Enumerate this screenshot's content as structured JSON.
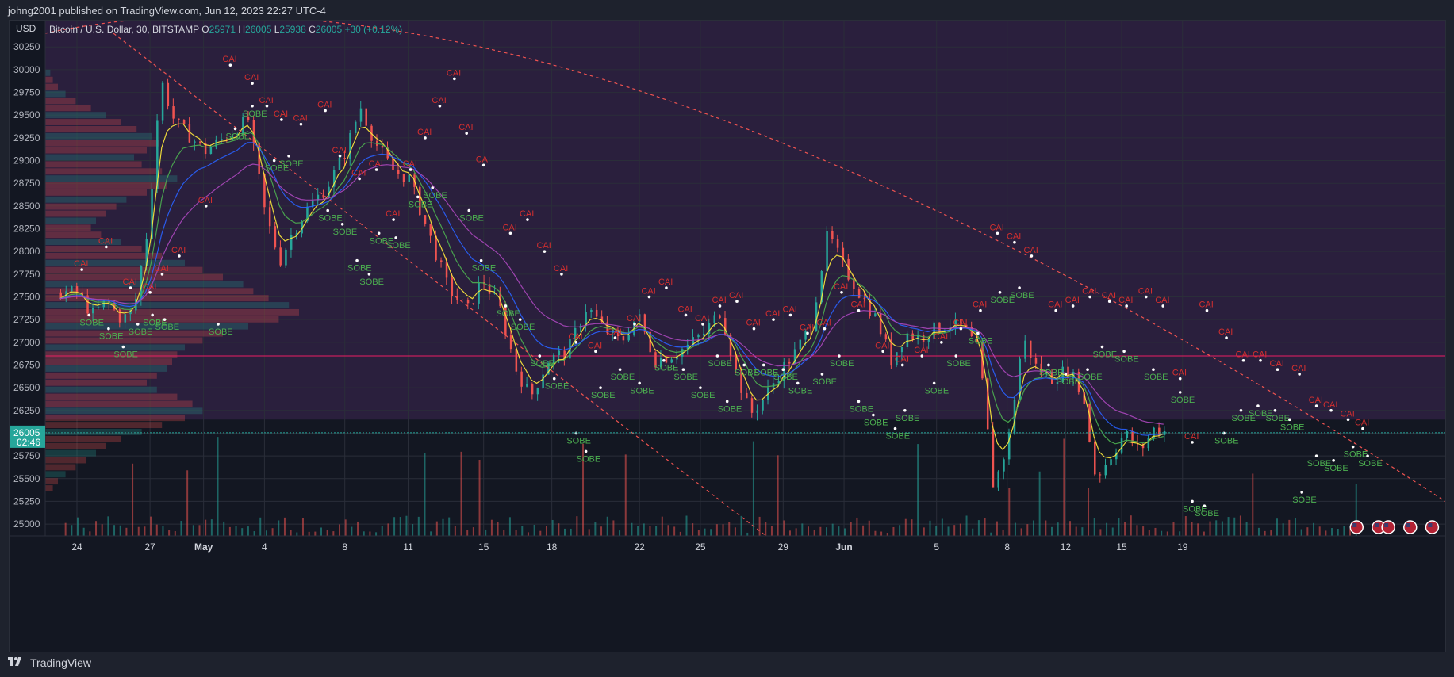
{
  "header": {
    "published": "johng2001 published on TradingView.com, Jun 12, 2023 22:27 UTC-4"
  },
  "footer": {
    "brand": "TradingView",
    "logo_icon": "tradingview-logo-icon"
  },
  "colors": {
    "up": "#26a69a",
    "down": "#ef5350",
    "bg": "#131722",
    "panel_bg": "#1e222d",
    "zone_upper": "#2a1f3d",
    "sobe": "#4caf50",
    "cai": "#d32f2f",
    "ema_fast": "#ffeb3b",
    "ema_mid": "#4caf50",
    "ema_slow": "#2962ff",
    "ema_slowest": "#ab47bc",
    "poc_line": "#e91e63",
    "trend_line": "#ef5350",
    "price_label": "#26a69a",
    "text": "#d1d4dc"
  },
  "chart_data": {
    "type": "candlestick",
    "symbol_line": "Bitcoin / U.S. Dollar, 30, BITSTAMP",
    "currency": "USD",
    "ohlc": {
      "o_label": "O",
      "o": "25971",
      "h_label": "H",
      "h": "26005",
      "l_label": "L",
      "l": "25938",
      "c_label": "C",
      "c": "26005",
      "change": "+30 (+0.12%)"
    },
    "last_price": "26005",
    "countdown": "02:46",
    "ylim": [
      24870,
      30540
    ],
    "y_ticks": [
      "30250",
      "30000",
      "29750",
      "29500",
      "29250",
      "29000",
      "28750",
      "28500",
      "28250",
      "28000",
      "27750",
      "27500",
      "27250",
      "27000",
      "26750",
      "26500",
      "26250",
      "26000",
      "25750",
      "25500",
      "25250",
      "25000"
    ],
    "x_ticks": [
      "24",
      "27",
      "May",
      "4",
      "8",
      "11",
      "15",
      "18",
      "22",
      "25",
      "29",
      "Jun",
      "5",
      "8",
      "12",
      "15",
      "19"
    ],
    "close_path_days": [
      0,
      0.6,
      1.2,
      1.8,
      2.3,
      2.9,
      3.4,
      4.0,
      4.5,
      5.2,
      6.0,
      7.0,
      7.7,
      8.3,
      8.8,
      9.5,
      10.2,
      11.0,
      11.6,
      12.2,
      12.9,
      13.6,
      14.4,
      15.2,
      16.0,
      16.6,
      17.3,
      18.0,
      18.6,
      19.3,
      20.1,
      20.9,
      21.6,
      22.3,
      23.0,
      23.7,
      24.3,
      25.0,
      25.7,
      26.4,
      27.0,
      27.6,
      28.2,
      28.9,
      29.5,
      30.1,
      30.8,
      31.5,
      32.2,
      32.8,
      33.4,
      34.0,
      34.6,
      35.2,
      35.8,
      36.4,
      37.0,
      37.6,
      38.2,
      38.8,
      39.4,
      40.0,
      40.6,
      41.2,
      41.8,
      42.4,
      43.0,
      43.6,
      44.2,
      44.8,
      45.4,
      46.0,
      46.6,
      47.2,
      47.8,
      48.4,
      49.0,
      49.6,
      50.2
    ],
    "close_path": [
      27550,
      27300,
      27450,
      27250,
      27350,
      28300,
      29900,
      29400,
      29300,
      29100,
      29250,
      29450,
      28400,
      27900,
      28200,
      28500,
      28700,
      29100,
      29600,
      29200,
      28900,
      28800,
      28200,
      27600,
      27350,
      27700,
      27400,
      26700,
      26400,
      26800,
      26900,
      27400,
      27150,
      27000,
      27300,
      26800,
      26850,
      26950,
      27100,
      27350,
      26700,
      26200,
      26400,
      26700,
      26900,
      27200,
      28200,
      27800,
      27500,
      27250,
      26800,
      27100,
      27050,
      27150,
      27200,
      27150,
      26900,
      25400,
      25900,
      27050,
      26700,
      26600,
      26700,
      26500,
      25500,
      25750,
      26000,
      25800,
      26050,
      26005
    ],
    "volume_profile_rows": 60,
    "volume_profile": [
      2,
      3,
      5,
      8,
      12,
      18,
      24,
      30,
      36,
      42,
      45,
      40,
      35,
      38,
      46,
      52,
      48,
      40,
      32,
      28,
      24,
      20,
      18,
      22,
      30,
      38,
      46,
      55,
      62,
      70,
      78,
      82,
      88,
      96,
      100,
      92,
      80,
      70,
      62,
      55,
      52,
      50,
      48,
      44,
      40,
      44,
      52,
      58,
      62,
      55,
      46,
      38,
      30,
      24,
      20,
      16,
      12,
      8,
      5,
      3
    ],
    "annotations": {
      "buy_label": "SOBE",
      "sell_label": "CAI"
    },
    "sobe_points": [
      [
        0.5,
        27300
      ],
      [
        1.3,
        27150
      ],
      [
        1.9,
        26950
      ],
      [
        2.5,
        27200
      ],
      [
        3.1,
        27300
      ],
      [
        3.6,
        27250
      ],
      [
        5.8,
        27200
      ],
      [
        6.5,
        29350
      ],
      [
        7.2,
        29600
      ],
      [
        8.1,
        29000
      ],
      [
        8.7,
        29050
      ],
      [
        10.3,
        28450
      ],
      [
        10.9,
        28300
      ],
      [
        11.5,
        27900
      ],
      [
        12.0,
        27750
      ],
      [
        12.4,
        28200
      ],
      [
        13.1,
        28150
      ],
      [
        14.0,
        28600
      ],
      [
        14.6,
        28700
      ],
      [
        16.1,
        28450
      ],
      [
        16.6,
        27900
      ],
      [
        17.6,
        27400
      ],
      [
        18.2,
        27250
      ],
      [
        19.0,
        26850
      ],
      [
        19.6,
        26600
      ],
      [
        20.5,
        26000
      ],
      [
        20.9,
        25800
      ],
      [
        21.5,
        26500
      ],
      [
        22.3,
        26700
      ],
      [
        23.1,
        26550
      ],
      [
        24.1,
        26800
      ],
      [
        24.9,
        26700
      ],
      [
        25.6,
        26500
      ],
      [
        26.3,
        26850
      ],
      [
        26.7,
        26350
      ],
      [
        27.4,
        26750
      ],
      [
        28.2,
        26750
      ],
      [
        29.0,
        26700
      ],
      [
        29.6,
        26550
      ],
      [
        30.6,
        26650
      ],
      [
        31.3,
        26850
      ],
      [
        32.1,
        26350
      ],
      [
        32.7,
        26200
      ],
      [
        33.6,
        26050
      ],
      [
        34.0,
        26250
      ],
      [
        35.2,
        26550
      ],
      [
        36.1,
        26850
      ],
      [
        37.0,
        27100
      ],
      [
        37.9,
        27550
      ],
      [
        38.7,
        27600
      ],
      [
        39.9,
        26750
      ],
      [
        40.6,
        26650
      ],
      [
        41.5,
        26700
      ],
      [
        42.1,
        26950
      ],
      [
        43.0,
        26900
      ],
      [
        44.2,
        26700
      ],
      [
        45.3,
        26450
      ],
      [
        45.8,
        25250
      ],
      [
        46.3,
        25200
      ],
      [
        47.1,
        26000
      ],
      [
        47.8,
        26250
      ],
      [
        48.5,
        26300
      ],
      [
        49.2,
        26250
      ],
      [
        49.8,
        26150
      ],
      [
        50.3,
        25350
      ],
      [
        50.9,
        25750
      ],
      [
        51.6,
        25700
      ],
      [
        52.4,
        25850
      ],
      [
        53.0,
        25750
      ]
    ],
    "cai_points": [
      [
        0.2,
        27800
      ],
      [
        1.2,
        28050
      ],
      [
        2.2,
        27600
      ],
      [
        3.0,
        27550
      ],
      [
        3.5,
        27750
      ],
      [
        4.2,
        27950
      ],
      [
        5.3,
        28500
      ],
      [
        6.3,
        30050
      ],
      [
        7.2,
        29850
      ],
      [
        7.8,
        29600
      ],
      [
        8.4,
        29450
      ],
      [
        9.2,
        29400
      ],
      [
        10.2,
        29550
      ],
      [
        10.8,
        29050
      ],
      [
        11.6,
        28800
      ],
      [
        12.3,
        28900
      ],
      [
        13.0,
        28350
      ],
      [
        13.7,
        28900
      ],
      [
        14.3,
        29250
      ],
      [
        14.9,
        29600
      ],
      [
        15.5,
        29900
      ],
      [
        16.0,
        29300
      ],
      [
        16.7,
        28950
      ],
      [
        17.8,
        28200
      ],
      [
        18.5,
        28350
      ],
      [
        19.2,
        28000
      ],
      [
        19.9,
        27750
      ],
      [
        20.5,
        27000
      ],
      [
        21.3,
        26900
      ],
      [
        22.1,
        27050
      ],
      [
        22.9,
        27200
      ],
      [
        23.5,
        27500
      ],
      [
        24.2,
        27600
      ],
      [
        25.0,
        27300
      ],
      [
        25.7,
        27200
      ],
      [
        26.4,
        27400
      ],
      [
        27.1,
        27450
      ],
      [
        27.8,
        27150
      ],
      [
        28.6,
        27250
      ],
      [
        29.3,
        27300
      ],
      [
        30.0,
        27100
      ],
      [
        30.7,
        27150
      ],
      [
        31.4,
        27550
      ],
      [
        32.1,
        27350
      ],
      [
        33.1,
        26900
      ],
      [
        33.9,
        26750
      ],
      [
        34.7,
        26850
      ],
      [
        35.5,
        27000
      ],
      [
        36.3,
        27150
      ],
      [
        37.1,
        27350
      ],
      [
        37.8,
        28200
      ],
      [
        38.5,
        28100
      ],
      [
        39.2,
        27950
      ],
      [
        40.2,
        27350
      ],
      [
        40.9,
        27400
      ],
      [
        41.6,
        27500
      ],
      [
        42.4,
        27450
      ],
      [
        43.1,
        27400
      ],
      [
        43.9,
        27500
      ],
      [
        44.6,
        27400
      ],
      [
        45.3,
        26600
      ],
      [
        45.8,
        25900
      ],
      [
        46.4,
        27350
      ],
      [
        47.2,
        27050
      ],
      [
        47.9,
        26800
      ],
      [
        48.6,
        26800
      ],
      [
        49.3,
        26700
      ],
      [
        50.2,
        26650
      ],
      [
        50.9,
        26300
      ],
      [
        51.5,
        26250
      ],
      [
        52.2,
        26150
      ],
      [
        52.8,
        26050
      ]
    ]
  }
}
